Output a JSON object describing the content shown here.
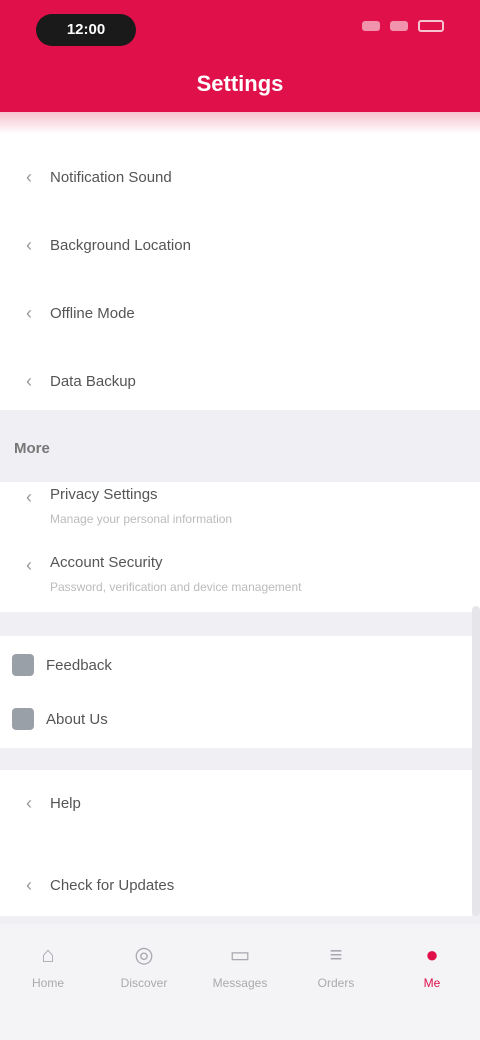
{
  "status_bar": {
    "time": "12:00"
  },
  "header": {
    "title": "Settings"
  },
  "card1": {
    "items": [
      {
        "label": "Notification Sound"
      },
      {
        "label": "Background Location"
      },
      {
        "label": "Offline Mode"
      },
      {
        "label": "Data Backup"
      }
    ]
  },
  "section": {
    "title": "More"
  },
  "card2": {
    "items": [
      {
        "label": "Privacy Settings",
        "sub": "Manage your personal information"
      },
      {
        "label": "Account Security",
        "sub": "Password, verification and device management"
      }
    ]
  },
  "card3": {
    "items": [
      {
        "label": "Feedback"
      },
      {
        "label": "About Us"
      }
    ]
  },
  "card4": {
    "items": [
      {
        "label": "Help"
      },
      {
        "label": "Check for Updates"
      }
    ]
  },
  "bottom_nav": {
    "items": [
      {
        "label": "Home",
        "icon": "home-icon"
      },
      {
        "label": "Discover",
        "icon": "compass-icon"
      },
      {
        "label": "Messages",
        "icon": "chat-icon"
      },
      {
        "label": "Orders",
        "icon": "list-icon"
      },
      {
        "label": "Me",
        "icon": "person-icon",
        "active": true
      }
    ]
  },
  "colors": {
    "brand": "#e0104a"
  }
}
